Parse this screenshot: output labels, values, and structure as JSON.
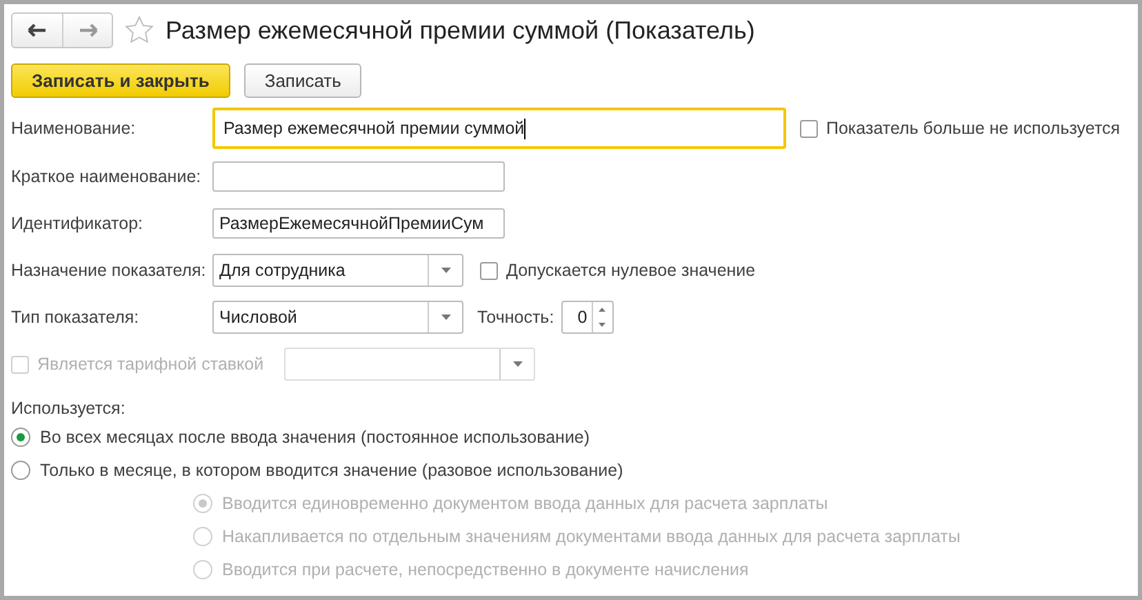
{
  "window": {
    "title": "Размер ежемесячной премии суммой (Показатель)",
    "favorite": false
  },
  "buttons": [
    {
      "label": "Записать и закрыть",
      "kind": "primary"
    },
    {
      "label": "Записать",
      "kind": "default"
    }
  ],
  "name": {
    "label": "Наименование:",
    "value": "Размер ежемесячной премии суммой",
    "focused": true
  },
  "not_used": {
    "label": "Показатель больше не используется",
    "checked": false,
    "disabled": false
  },
  "short_name": {
    "label": "Краткое наименование:",
    "focused": false
  },
  "identifier": {
    "label": "Идентификатор:",
    "value": "РазмерЕжемесячнойПремииСум",
    "focused": false
  },
  "purpose": {
    "label": "Назначение показателя:",
    "value": "Для сотрудника",
    "disabled": false
  },
  "allow_zero": {
    "label": "Допускается нулевое значение",
    "checked": false,
    "disabled": false
  },
  "type": {
    "label": "Тип показателя:",
    "value": "Числовой",
    "disabled": false
  },
  "precision": {
    "label": "Точность:",
    "value": "0"
  },
  "tariff": {
    "label": "Является тарифной ставкой",
    "checked": false,
    "disabled": true
  },
  "tariff_select": {
    "disabled": true
  },
  "usage": {
    "label": "Используется:",
    "options": [
      {
        "label": "Во всех месяцах после ввода значения (постоянное использование)",
        "selected": true,
        "disabled": false
      },
      {
        "label": "Только в месяце, в котором вводится значение (разовое использование)",
        "selected": false,
        "disabled": false
      }
    ],
    "sub_options": [
      {
        "label": "Вводится единовременно документом ввода данных для расчета зарплаты",
        "selected": true,
        "disabled": true
      },
      {
        "label": "Накапливается по отдельным значениям документами ввода данных для расчета зарплаты",
        "selected": false,
        "disabled": true
      },
      {
        "label": "Вводится при расчете, непосредственно в документе начисления",
        "selected": false,
        "disabled": true
      }
    ]
  }
}
